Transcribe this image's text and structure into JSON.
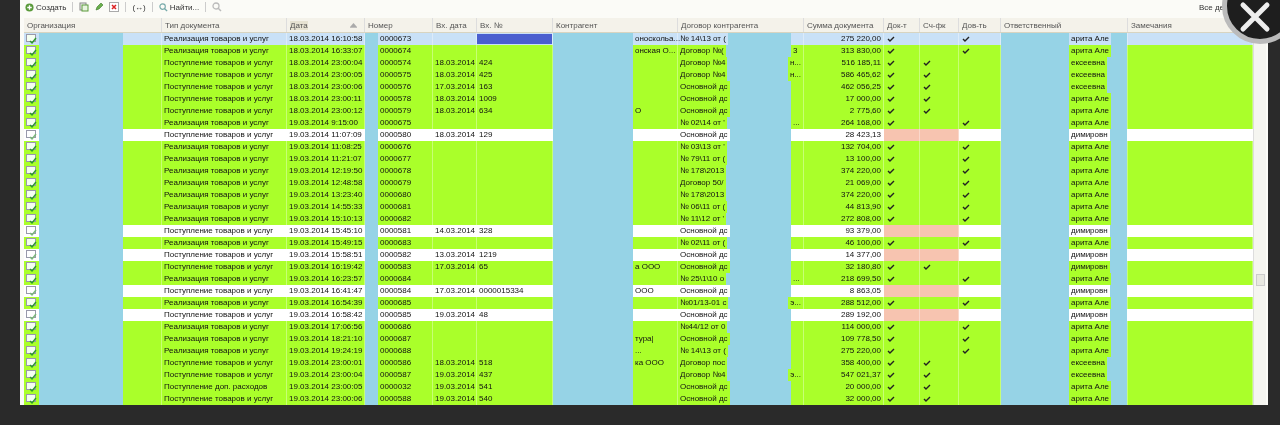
{
  "toolbar": [
    {
      "kind": "create",
      "label": "Создать"
    },
    {
      "kind": "copy"
    },
    {
      "kind": "edit"
    },
    {
      "kind": "delete"
    },
    {
      "kind": "interval",
      "label": "(↔)"
    },
    {
      "kind": "find",
      "label": "Найти..."
    },
    {
      "kind": "search"
    }
  ],
  "filter_label": "Все де",
  "columns": [
    {
      "label": "Организация",
      "sorted": false
    },
    {
      "label": "Тип документа",
      "sorted": false
    },
    {
      "label": "Дата",
      "sorted": true
    },
    {
      "label": "Номер",
      "sorted": false
    },
    {
      "label": "Вх. дата",
      "sorted": false
    },
    {
      "label": "Вх. №",
      "sorted": false
    },
    {
      "label": "Контрагент",
      "sorted": false
    },
    {
      "label": "Договор контрагента",
      "sorted": false
    },
    {
      "label": "Сумма документа",
      "sorted": false
    },
    {
      "label": "Док-т",
      "sorted": false
    },
    {
      "label": "Сч-фк",
      "sorted": false
    },
    {
      "label": "Дов-ть",
      "sorted": false
    },
    {
      "label": "Ответственный",
      "sorted": false
    },
    {
      "label": "Замечания",
      "sorted": false
    }
  ],
  "rows": [
    {
      "kind": "posted",
      "selected": true,
      "type": "Реализация товаров и услуг",
      "date": "18.03.2014 16:10:58",
      "number": "0000673",
      "counterparty": "оноскольа...",
      "contract": "№ 14\\13 от (",
      "sum": "275 220,00",
      "doc": true,
      "invoice": false,
      "proxy": true,
      "responsible": "арита Але"
    },
    {
      "kind": "posted",
      "selected": false,
      "type": "Реализация товаров и услуг",
      "date": "18.03.2014 16:33:07",
      "number": "0000674",
      "counterparty": "онская О...",
      "contract": "Договор №(",
      "contract_tail": "3",
      "sum": "313 830,00",
      "doc": true,
      "invoice": false,
      "proxy": true,
      "responsible": "арита Але"
    },
    {
      "kind": "posted",
      "selected": false,
      "type": "Поступление товаров и услуг",
      "date": "18.03.2014 23:00:04",
      "number": "0000574",
      "in_date": "18.03.2014",
      "in_number": "424",
      "contract": "Договор №4",
      "contract_tail": "н...",
      "sum": "516 185,11",
      "doc": true,
      "invoice": true,
      "proxy": false,
      "responsible": "ексеевна"
    },
    {
      "kind": "posted",
      "selected": false,
      "type": "Поступление товаров и услуг",
      "date": "18.03.2014 23:00:05",
      "number": "0000575",
      "in_date": "18.03.2014",
      "in_number": "425",
      "contract": "Договор №4",
      "contract_tail": "н...",
      "sum": "586 465,62",
      "doc": true,
      "invoice": true,
      "proxy": false,
      "responsible": "ексеевна"
    },
    {
      "kind": "posted",
      "selected": false,
      "type": "Поступление товаров и услуг",
      "date": "18.03.2014 23:00:06",
      "number": "0000576",
      "in_date": "17.03.2014",
      "in_number": "163",
      "contract": "Основной дс",
      "sum": "462 056,25",
      "doc": true,
      "invoice": true,
      "proxy": false,
      "responsible": "ексеевна"
    },
    {
      "kind": "posted",
      "selected": false,
      "type": "Поступление товаров и услуг",
      "date": "18.03.2014 23:00:11",
      "number": "0000578",
      "in_date": "18.03.2014",
      "in_number": "1009",
      "contract": "Основной дс",
      "sum": "17 000,00",
      "doc": true,
      "invoice": true,
      "proxy": false,
      "responsible": "арита Але"
    },
    {
      "kind": "posted",
      "selected": false,
      "type": "Поступление товаров и услуг",
      "date": "18.03.2014 23:00:12",
      "number": "0000579",
      "in_date": "18.03.2014",
      "in_number": "634",
      "counterparty": "О",
      "contract": "Основной дс",
      "sum": "2 775,60",
      "doc": true,
      "invoice": true,
      "proxy": false,
      "responsible": "арита Але"
    },
    {
      "kind": "posted",
      "selected": false,
      "type": "Реализация товаров и услуг",
      "date": "19.03.2014 9:15:00",
      "number": "0000675",
      "contract": "№ 02\\14 от '",
      "contract_tail": "...",
      "sum": "264 168,00",
      "doc": true,
      "invoice": false,
      "proxy": true,
      "responsible": "арита Але"
    },
    {
      "kind": "unposted",
      "selected": false,
      "type": "Поступление товаров и услуг",
      "date": "19.03.2014 11:07:09",
      "number": "0000580",
      "in_date": "18.03.2014",
      "in_number": "129",
      "contract": "Основной дс",
      "sum": "28 423,13",
      "doc": false,
      "invoice": false,
      "proxy": false,
      "responsible": "димировн"
    },
    {
      "kind": "posted",
      "selected": false,
      "type": "Реализация товаров и услуг",
      "date": "19.03.2014 11:08:25",
      "number": "0000676",
      "contract": "№ 03\\13 от '",
      "sum": "132 704,00",
      "doc": true,
      "invoice": false,
      "proxy": true,
      "responsible": "арита Але"
    },
    {
      "kind": "posted",
      "selected": false,
      "type": "Реализация товаров и услуг",
      "date": "19.03.2014 11:21:07",
      "number": "0000677",
      "contract": "№ 79\\11 от (",
      "sum": "13 100,00",
      "doc": true,
      "invoice": false,
      "proxy": true,
      "responsible": "арита Але"
    },
    {
      "kind": "posted",
      "selected": false,
      "type": "Реализация товаров и услуг",
      "date": "19.03.2014 12:19:50",
      "number": "0000678",
      "contract": "№ 178\\2013",
      "sum": "374 220,00",
      "doc": true,
      "invoice": false,
      "proxy": true,
      "responsible": "арита Але"
    },
    {
      "kind": "posted",
      "selected": false,
      "type": "Реализация товаров и услуг",
      "date": "19.03.2014 12:48:58",
      "number": "0000679",
      "contract": "Договор 50/",
      "sum": "21 069,00",
      "doc": true,
      "invoice": false,
      "proxy": true,
      "responsible": "арита Але"
    },
    {
      "kind": "posted",
      "selected": false,
      "type": "Реализация товаров и услуг",
      "date": "19.03.2014 13:23:40",
      "number": "0000680",
      "contract": "№ 178\\2013",
      "sum": "374 220,00",
      "doc": true,
      "invoice": false,
      "proxy": true,
      "responsible": "арита Але"
    },
    {
      "kind": "posted",
      "selected": false,
      "type": "Реализация товаров и услуг",
      "date": "19.03.2014 14:55:33",
      "number": "0000681",
      "contract": "№ 06\\11 от (",
      "sum": "44 813,90",
      "doc": true,
      "invoice": false,
      "proxy": true,
      "responsible": "арита Але"
    },
    {
      "kind": "posted",
      "selected": false,
      "type": "Реализация товаров и услуг",
      "date": "19.03.2014 15:10:13",
      "number": "0000682",
      "contract": "№ 11\\12 от '",
      "sum": "272 808,00",
      "doc": true,
      "invoice": false,
      "proxy": true,
      "responsible": "арита Але"
    },
    {
      "kind": "unposted",
      "selected": false,
      "type": "Поступление товаров и услуг",
      "date": "19.03.2014 15:45:10",
      "number": "0000581",
      "in_date": "14.03.2014",
      "in_number": "328",
      "contract": "Основной дс",
      "sum": "93 379,00",
      "doc": false,
      "invoice": false,
      "proxy": false,
      "responsible": "димировн"
    },
    {
      "kind": "posted",
      "selected": false,
      "type": "Реализация товаров и услуг",
      "date": "19.03.2014 15:49:15",
      "number": "0000683",
      "contract": "№ 02\\11 от (",
      "sum": "46 100,00",
      "doc": true,
      "invoice": false,
      "proxy": true,
      "responsible": "арита Але"
    },
    {
      "kind": "unposted",
      "selected": false,
      "type": "Поступление товаров и услуг",
      "date": "19.03.2014 15:58:51",
      "number": "0000582",
      "in_date": "13.03.2014",
      "in_number": "1219",
      "contract": "Основной дс",
      "sum": "14 377,00",
      "doc": false,
      "invoice": false,
      "proxy": false,
      "responsible": "димировн"
    },
    {
      "kind": "posted",
      "selected": false,
      "type": "Поступление товаров и услуг",
      "date": "19.03.2014 16:19:42",
      "number": "0000583",
      "in_date": "17.03.2014",
      "in_number": "65",
      "counterparty": "а ООО",
      "contract": "Основной дс",
      "sum": "32 180,80",
      "doc": true,
      "invoice": true,
      "proxy": false,
      "responsible": "димировн"
    },
    {
      "kind": "posted",
      "selected": false,
      "type": "Реализация товаров и услуг",
      "date": "19.03.2014 16:23:57",
      "number": "0000684",
      "contract": "№ 25\\1\\10 о",
      "contract_tail": "...",
      "sum": "218 699,50",
      "doc": true,
      "invoice": false,
      "proxy": true,
      "responsible": "арита Але"
    },
    {
      "kind": "unposted",
      "selected": false,
      "type": "Поступление товаров и услуг",
      "date": "19.03.2014 16:41:47",
      "number": "0000584",
      "in_date": "17.03.2014",
      "in_number": "0000015334",
      "counterparty": "ООО",
      "contract": "Основной дс",
      "sum": "8 863,05",
      "doc": false,
      "invoice": false,
      "proxy": false,
      "responsible": "димировн"
    },
    {
      "kind": "posted",
      "selected": false,
      "type": "Реализация товаров и услуг",
      "date": "19.03.2014 16:54:39",
      "number": "0000685",
      "contract": "№01/13-01 с",
      "contract_tail": "э...",
      "sum": "288 512,00",
      "doc": true,
      "invoice": false,
      "proxy": true,
      "responsible": "арита Але"
    },
    {
      "kind": "unposted",
      "selected": false,
      "type": "Поступление товаров и услуг",
      "date": "19.03.2014 16:58:42",
      "number": "0000585",
      "in_date": "19.03.2014",
      "in_number": "48",
      "contract": "Основной дс",
      "sum": "289 192,00",
      "doc": false,
      "invoice": false,
      "proxy": false,
      "responsible": "димировн"
    },
    {
      "kind": "posted",
      "selected": false,
      "type": "Реализация товаров и услуг",
      "date": "19.03.2014 17:06:56",
      "number": "0000686",
      "contract": "№44/12 от 0",
      "sum": "114 000,00",
      "doc": true,
      "invoice": false,
      "proxy": true,
      "responsible": "арита Але"
    },
    {
      "kind": "posted",
      "selected": false,
      "type": "Реализация товаров и услуг",
      "date": "19.03.2014 18:21:10",
      "number": "0000687",
      "counterparty": "тура|",
      "contract": "Основной дс",
      "sum": "109 778,50",
      "doc": true,
      "invoice": false,
      "proxy": true,
      "responsible": "арита Але"
    },
    {
      "kind": "posted",
      "selected": false,
      "type": "Реализация товаров и услуг",
      "date": "19.03.2014 19:24:19",
      "number": "0000688",
      "counterparty": "...",
      "contract": "№ 14\\13 от (",
      "sum": "275 220,00",
      "doc": true,
      "invoice": false,
      "proxy": true,
      "responsible": "арита Але"
    },
    {
      "kind": "posted",
      "selected": false,
      "type": "Поступление товаров и услуг",
      "date": "19.03.2014 23:00:01",
      "number": "0000586",
      "in_date": "18.03.2014",
      "in_number": "518",
      "counterparty": "ка ООО",
      "contract": "Договор пос",
      "sum": "358 400,00",
      "doc": true,
      "invoice": true,
      "proxy": false,
      "responsible": "ексеевна"
    },
    {
      "kind": "posted",
      "selected": false,
      "type": "Поступление товаров и услуг",
      "date": "19.03.2014 23:00:04",
      "number": "0000587",
      "in_date": "19.03.2014",
      "in_number": "437",
      "contract": "Договор №4",
      "contract_tail": "э...",
      "sum": "547 021,37",
      "doc": true,
      "invoice": true,
      "proxy": false,
      "responsible": "ексеевна"
    },
    {
      "kind": "posted",
      "selected": false,
      "type": "Поступление доп. расходов",
      "date": "19.03.2014 23:00:05",
      "number": "0000032",
      "in_date": "19.03.2014",
      "in_number": "541",
      "contract": "Основной дс",
      "sum": "20 000,00",
      "doc": true,
      "invoice": true,
      "proxy": false,
      "responsible": "арита Але"
    },
    {
      "kind": "posted",
      "selected": false,
      "type": "Поступление товаров и услуг",
      "date": "19.03.2014 23:00:06",
      "number": "0000588",
      "in_date": "19.03.2014",
      "in_number": "540",
      "contract": "Основной дс",
      "sum": "32 000,00",
      "doc": true,
      "invoice": true,
      "proxy": false,
      "responsible": "арита Але"
    }
  ]
}
